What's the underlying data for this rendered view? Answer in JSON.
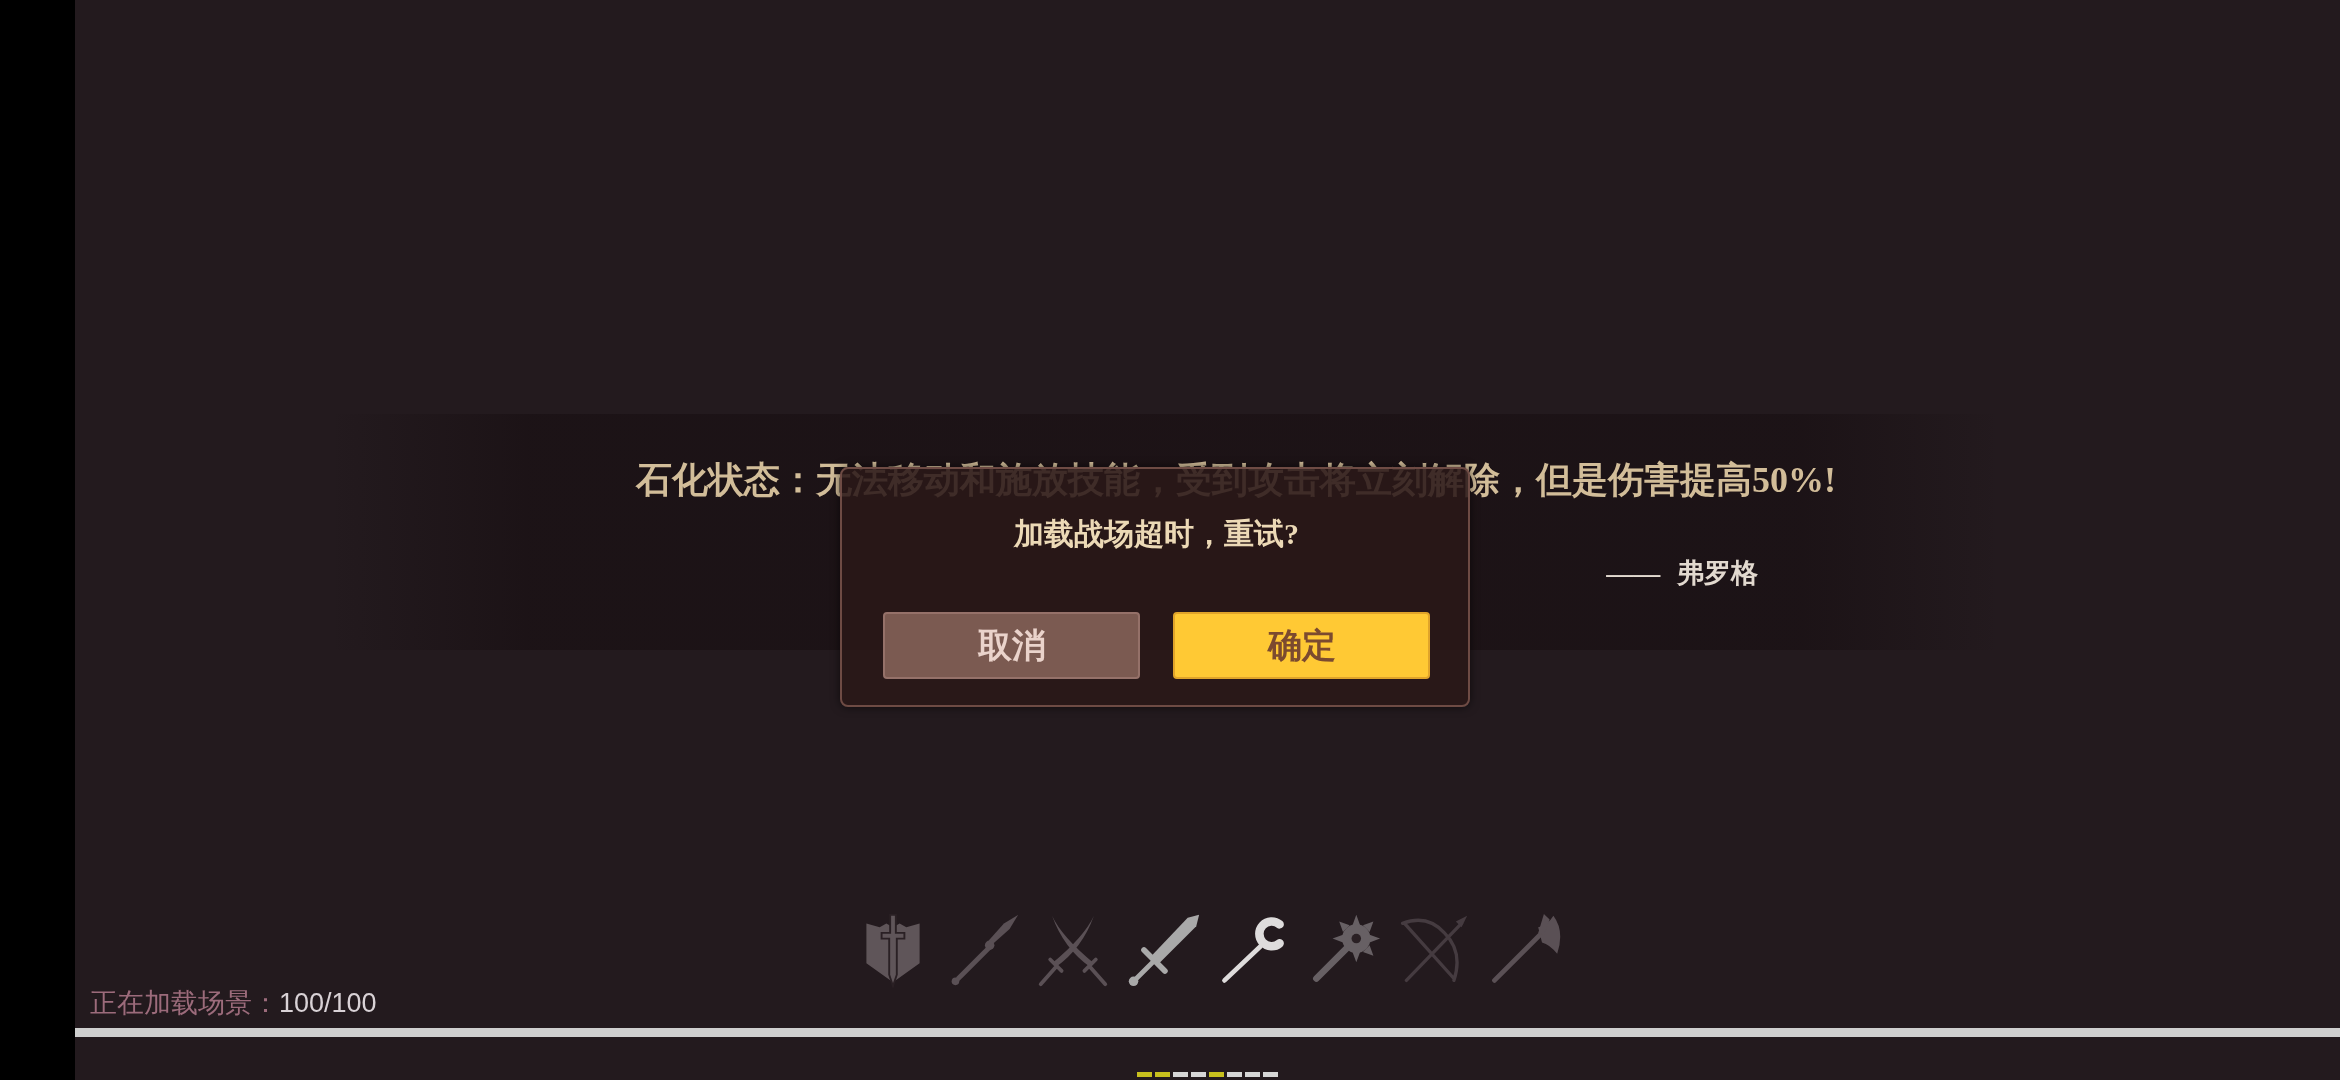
{
  "tip": {
    "text": "石化状态：无法移动和施放技能，受到攻击将立刻解除，但是伤害提高50%!",
    "attribution": "—— 弗罗格"
  },
  "dialog": {
    "message": "加载战场超时，重试?",
    "buttons": [
      {
        "label": "取消",
        "kind": "secondary"
      },
      {
        "label": "确定",
        "kind": "primary"
      }
    ]
  },
  "weapons": [
    {
      "kind": "shield",
      "color": "#5f5559"
    },
    {
      "kind": "spear",
      "color": "#5a5055"
    },
    {
      "kind": "scimitars",
      "color": "#5a5055"
    },
    {
      "kind": "sword",
      "color": "#a9a9a9"
    },
    {
      "kind": "staff",
      "color": "#dedcdc"
    },
    {
      "kind": "mace",
      "color": "#676064"
    },
    {
      "kind": "bow",
      "color": "#453b40"
    },
    {
      "kind": "axe",
      "color": "#5a5055"
    }
  ],
  "loading": {
    "label": "正在加载场景：",
    "value": "100/100",
    "level": 1
  },
  "page_dots": [
    {
      "on": true
    },
    {
      "on": true
    },
    {
      "on": false
    },
    {
      "on": false
    },
    {
      "on": true
    },
    {
      "on": false
    },
    {
      "on": false
    },
    {
      "on": false
    }
  ]
}
